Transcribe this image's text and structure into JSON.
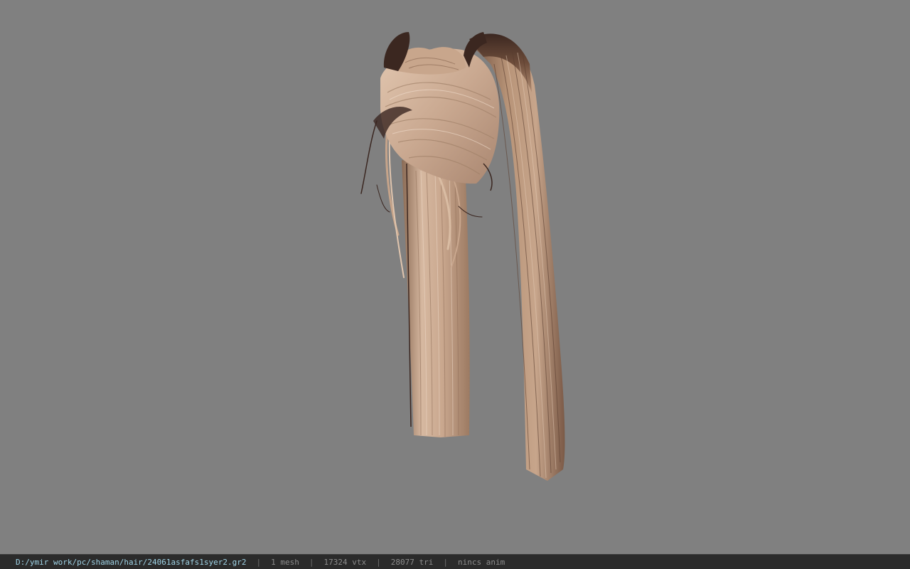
{
  "viewer": {
    "background_color": "#808080",
    "model_semantic": "hair-mesh",
    "hair_colors": {
      "light": "#d9bca3",
      "mid": "#b99478",
      "dark": "#6b4a38",
      "root": "#3a2620"
    }
  },
  "status": {
    "file_path": "D:/ymir work/pc/shaman/hair/24061asfafs1syer2.gr2",
    "separator": "|",
    "mesh_count": "1 mesh",
    "vertex_count": "17324 vtx",
    "triangle_count": "28077 tri",
    "anim": "nincs anim"
  }
}
